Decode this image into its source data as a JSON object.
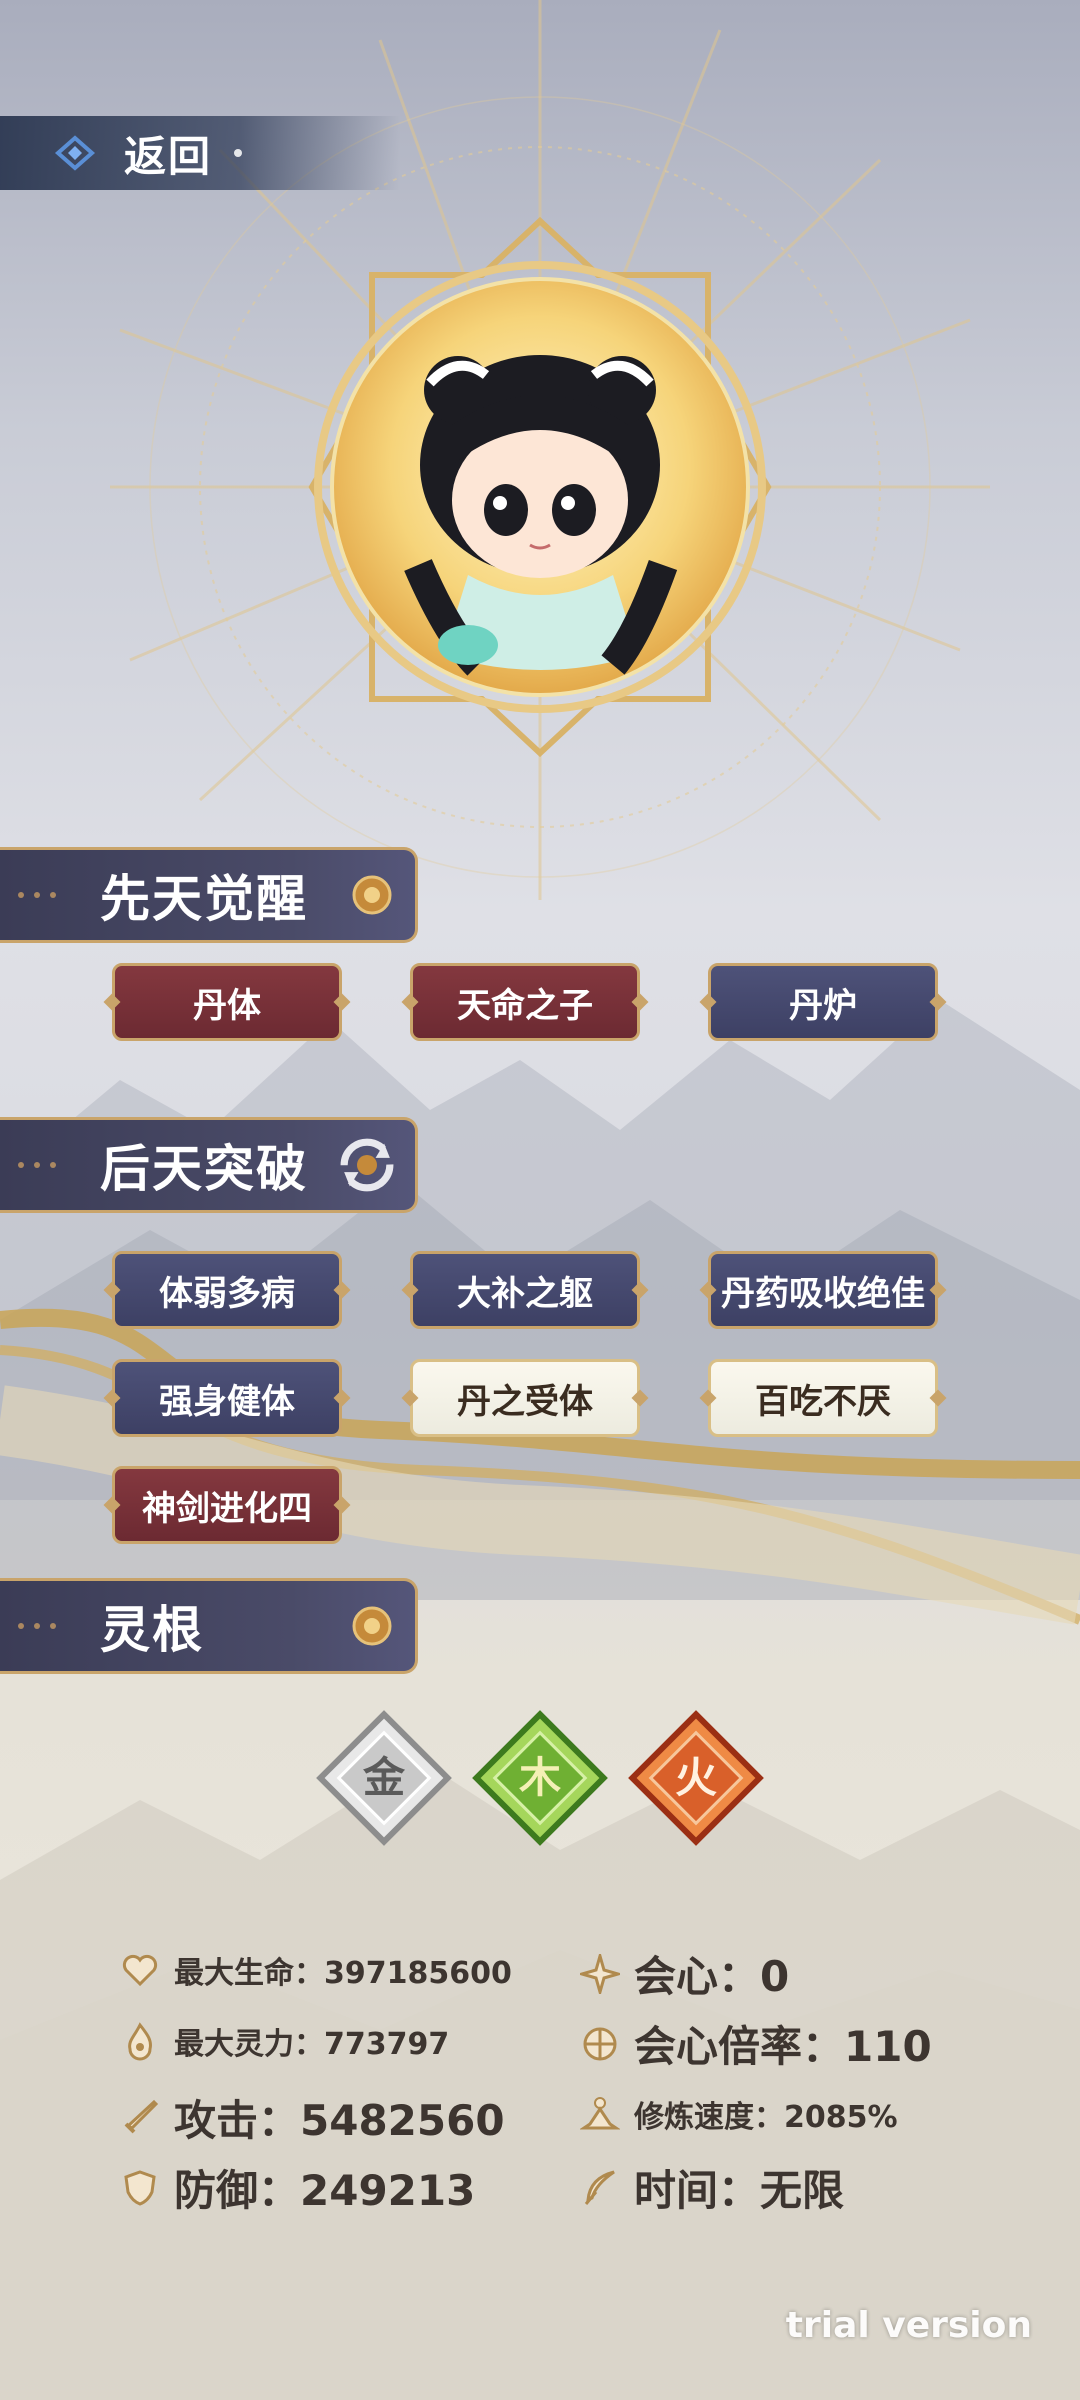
{
  "header": {
    "back_label": "返回"
  },
  "innate": {
    "title": "先天觉醒",
    "traits": [
      {
        "label": "丹体",
        "style": "red"
      },
      {
        "label": "天命之子",
        "style": "red"
      },
      {
        "label": "丹炉",
        "style": "navy"
      }
    ]
  },
  "acquired": {
    "title": "后天突破",
    "traits": [
      {
        "label": "体弱多病",
        "style": "navy"
      },
      {
        "label": "大补之躯",
        "style": "navy"
      },
      {
        "label": "丹药吸收绝佳",
        "style": "navy"
      },
      {
        "label": "强身健体",
        "style": "navy"
      },
      {
        "label": "丹之受体",
        "style": "light"
      },
      {
        "label": "百吃不厌",
        "style": "light"
      },
      {
        "label": "神剑进化四",
        "style": "red"
      }
    ]
  },
  "spirit_root": {
    "title": "灵根",
    "elements": [
      {
        "glyph": "金",
        "icon": "metal-element-icon",
        "color": "#b9b9b9"
      },
      {
        "glyph": "木",
        "icon": "wood-element-icon",
        "color": "#7fb93c"
      },
      {
        "glyph": "火",
        "icon": "fire-element-icon",
        "color": "#d9602a"
      }
    ]
  },
  "stats": {
    "max_hp": "最大生命：397185600",
    "max_spirit": "最大灵力：773797",
    "attack": "攻击：5482560",
    "defense": "防御：249213",
    "crit": "会心：0",
    "crit_multiplier": "会心倍率：110",
    "cultivation_speed": "修炼速度：2085%",
    "time": "时间：无限"
  },
  "watermark": "trial version",
  "colors": {
    "gold": "#c9a46a",
    "navy": "#3d4064",
    "crimson": "#6c2a32",
    "text": "#3d3530"
  }
}
